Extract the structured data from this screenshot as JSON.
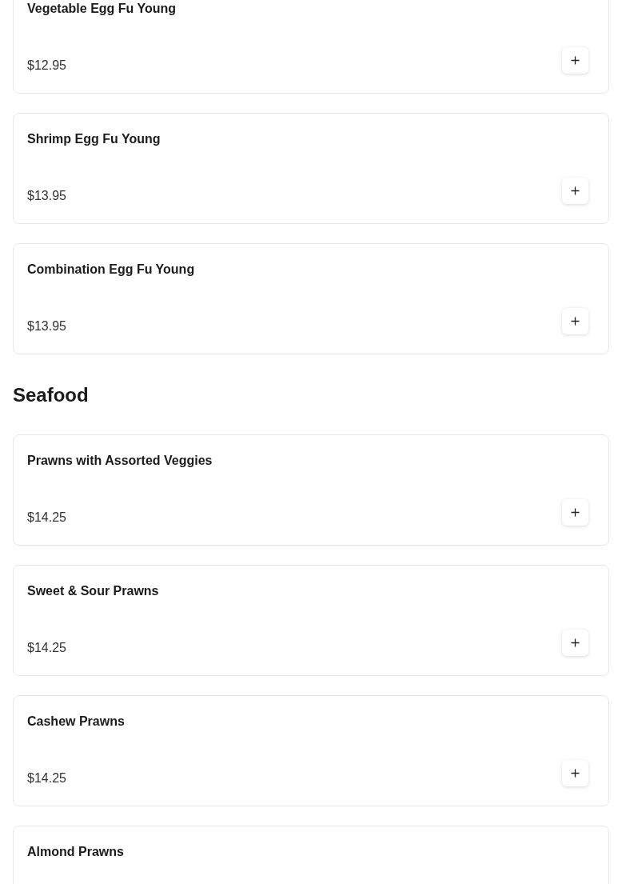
{
  "sections": [
    {
      "items": [
        {
          "name": "Vegetable Egg Fu Young",
          "price": "$12.95"
        },
        {
          "name": "Shrimp Egg Fu Young",
          "price": "$13.95"
        },
        {
          "name": "Combination Egg Fu Young",
          "price": "$13.95"
        }
      ]
    },
    {
      "title": "Seafood",
      "items": [
        {
          "name": "Prawns with Assorted Veggies",
          "price": "$14.25"
        },
        {
          "name": "Sweet & Sour Prawns",
          "price": "$14.25"
        },
        {
          "name": "Cashew Prawns",
          "price": "$14.25"
        },
        {
          "name": "Almond Prawns"
        }
      ]
    }
  ]
}
